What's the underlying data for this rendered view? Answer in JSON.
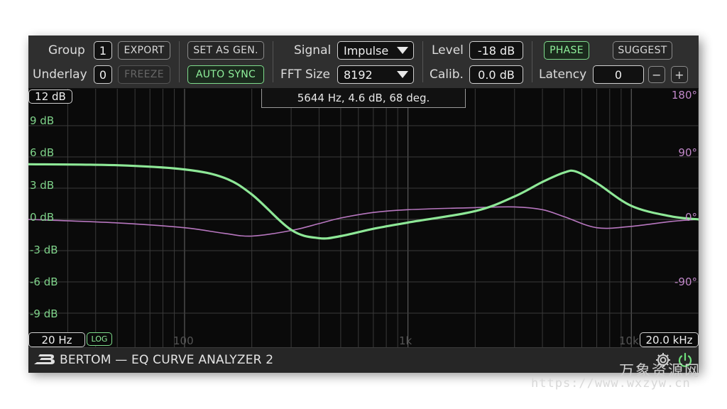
{
  "toolbar": {
    "group_label": "Group",
    "group_value": "1",
    "underlay_label": "Underlay",
    "underlay_value": "0",
    "export_label": "EXPORT",
    "freeze_label": "FREEZE",
    "set_as_gen_label": "SET AS GEN.",
    "auto_sync_label": "AUTO SYNC",
    "signal_label": "Signal",
    "signal_value": "Impulse",
    "fft_label": "FFT Size",
    "fft_value": "8192",
    "level_label": "Level",
    "level_value": "-18 dB",
    "calib_label": "Calib.",
    "calib_value": "0.0 dB",
    "phase_label": "PHASE",
    "suggest_label": "SUGGEST",
    "latency_label": "Latency",
    "latency_value": "0",
    "minus_label": "−",
    "plus_label": "+"
  },
  "plot": {
    "range_top": "12 dB",
    "readout": "5644 Hz, 4.6 dB, 68 deg.",
    "freq_low": "20 Hz",
    "freq_high": "20.0 kHz",
    "log_label": "LOG",
    "db_ticks": [
      "9 dB",
      "6 dB",
      "3 dB",
      "0 dB",
      "-3 dB",
      "-6 dB",
      "-9 dB"
    ],
    "phase_ticks": [
      "180°",
      "90°",
      "0°",
      "-90°"
    ],
    "freq_ticks": [
      "100",
      "1k",
      "10k"
    ]
  },
  "footer": {
    "brand": "BERTOM — EQ CURVE ANALYZER 2"
  },
  "watermark": {
    "cn": "万象资源网",
    "url": "https://www.wxzyw.cn"
  },
  "colors": {
    "magnitude": "#8ee897",
    "phase": "#b877c0",
    "db_labels": "#7fd38a",
    "phase_labels": "#c087c8"
  },
  "chart_data": {
    "type": "line",
    "x_scale": "log",
    "xlim": [
      20,
      20000
    ],
    "ylim": [
      -12,
      12
    ],
    "y2lim": [
      -180,
      180
    ],
    "series": [
      {
        "role": "magnitude",
        "x": [
          20,
          50,
          100,
          150,
          200,
          300,
          400,
          500,
          700,
          1000,
          2000,
          3000,
          4000,
          5000,
          5644,
          7000,
          10000,
          15000,
          20000
        ],
        "y": [
          5.3,
          5.2,
          4.8,
          4.0,
          2.4,
          -1.0,
          -1.8,
          -1.6,
          -0.9,
          -0.3,
          0.8,
          2.2,
          3.6,
          4.5,
          4.6,
          3.5,
          1.3,
          0.3,
          0.0
        ]
      },
      {
        "role": "phase",
        "x": [
          20,
          50,
          100,
          150,
          200,
          300,
          400,
          500,
          700,
          1000,
          2000,
          3000,
          4000,
          5000,
          7000,
          10000,
          15000,
          20000
        ],
        "y": [
          0,
          -5,
          -12,
          -20,
          -24,
          -16,
          -6,
          2,
          10,
          14,
          17,
          18,
          14,
          4,
          -12,
          -10,
          -3,
          0
        ]
      }
    ]
  }
}
